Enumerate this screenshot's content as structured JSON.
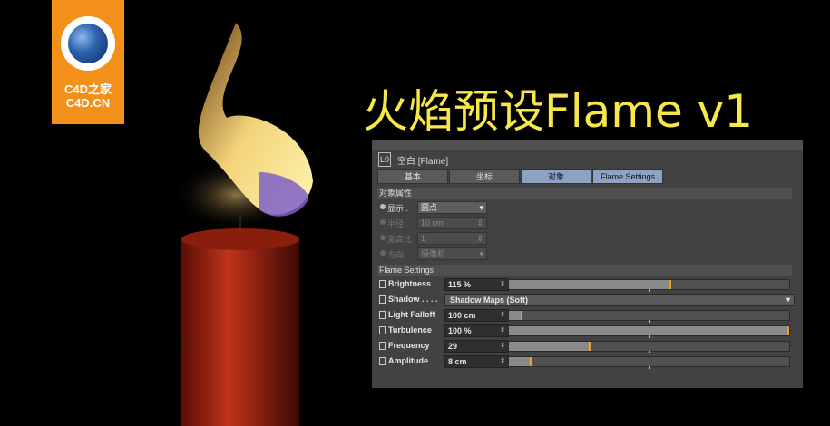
{
  "logo": {
    "text_cn": "C4D之家",
    "text_domain": "C4D.CN"
  },
  "title": "火焰预设Flame v1",
  "panel": {
    "object_name": "空白 [Flame]",
    "tabs": [
      {
        "label": "基本",
        "active": false
      },
      {
        "label": "坐标",
        "active": false
      },
      {
        "label": "对象",
        "active": true
      },
      {
        "label": "Flame Settings",
        "active": true
      }
    ],
    "object_section": {
      "title": "对象属性",
      "display": {
        "label": "显示 .",
        "value": "圆点"
      },
      "radius": {
        "label": "半径 .",
        "value": "10 cm"
      },
      "aspect": {
        "label": "宽高比",
        "value": "1"
      },
      "orientation": {
        "label": "方向 .",
        "value": "摄像机"
      }
    },
    "flame_section": {
      "title": "Flame Settings",
      "brightness": {
        "label": "Brightness",
        "value": "115 %",
        "fraction": 0.58
      },
      "shadow": {
        "label": "Shadow . . . .",
        "value": "Shadow Maps (Soft)"
      },
      "light_falloff": {
        "label": "Light Falloff",
        "value": "100 cm",
        "fraction": 0.05
      },
      "turbulence": {
        "label": "Turbulence",
        "value": "100 %",
        "fraction": 1.0
      },
      "frequency": {
        "label": "Frequency",
        "value": "29",
        "fraction": 0.29
      },
      "amplitude": {
        "label": "Amplitude",
        "value": "8 cm",
        "fraction": 0.08
      }
    }
  },
  "colors": {
    "accent": "#f7e84a",
    "logo_bg": "#f39019",
    "slider_knob": "#f0a020",
    "active_tab": "#8da3c3"
  }
}
